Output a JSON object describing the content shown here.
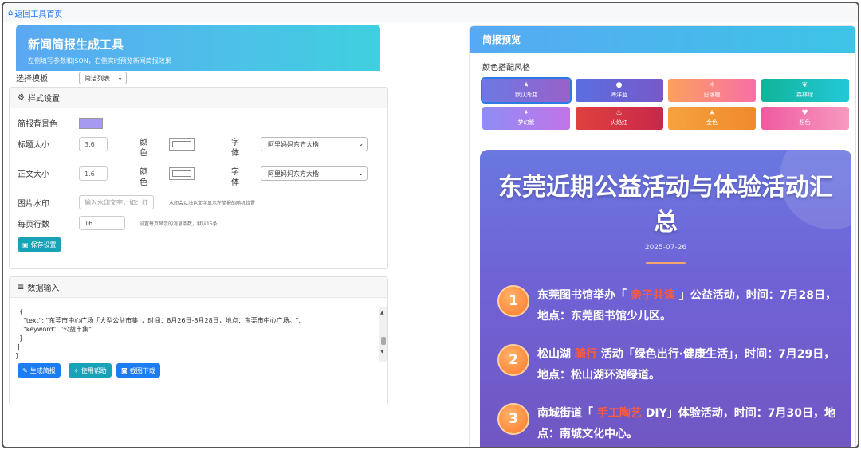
{
  "topbar": {
    "back_label": "返回工具首页"
  },
  "header": {
    "title": "新闻简报生成工具",
    "subtitle": "左侧填写参数和JSON，右侧实时预览新闻简报效果"
  },
  "template": {
    "label": "选择模板",
    "selected": "简洁列表"
  },
  "style_settings": {
    "heading": "样式设置",
    "bg_label": "简报背景色",
    "bg_color": "#a599f0",
    "title_size_label": "标题大小",
    "title_size": "3.6",
    "color_label": "颜色",
    "font_label": "字体",
    "title_font": "阿里妈妈东方大楷",
    "body_size_label": "正文大小",
    "body_size": "1.6",
    "body_font": "阿里妈妈东方大楷",
    "watermark_label": "图片水印",
    "watermark_placeholder": "输入水印文字，如：红",
    "watermark_hint": "水印会以浅色文字显示在简报的随机位置",
    "rows_label": "每页行数",
    "rows_value": "16",
    "rows_hint": "设置每页显示的消息条数，默认15条",
    "save_label": "保存设置"
  },
  "data_input": {
    "heading": "数据输入",
    "json_lines": [
      "  {",
      "    \"text\": \"东莞市中心广场「大型公益市集」，时间：8月26日-8月28日，地点：东莞市中心广场。\",",
      "    \"keyword\": \"公益市集\"",
      "  }",
      " ]",
      "}"
    ],
    "generate_label": "生成简报",
    "help_label": "使用帮助",
    "download_label": "截图下载"
  },
  "preview": {
    "heading": "简报预览",
    "scheme_title": "颜色搭配风格",
    "schemes": [
      {
        "label": "默认渐变",
        "icon": "★",
        "colors": [
          "#6c78e4",
          "#9a61c8"
        ],
        "selected": true
      },
      {
        "label": "海洋蓝",
        "icon": "●",
        "colors": [
          "#5b6fe0",
          "#7858c8"
        ]
      },
      {
        "label": "日落橙",
        "icon": "☼",
        "colors": [
          "#fba15e",
          "#f86fa6"
        ]
      },
      {
        "label": "森林绿",
        "icon": "❦",
        "colors": [
          "#11b49a",
          "#23c8d8"
        ]
      },
      {
        "label": "梦幻紫",
        "icon": "✦",
        "colors": [
          "#8f8cf4",
          "#c274e8"
        ]
      },
      {
        "label": "火焰红",
        "icon": "♨",
        "colors": [
          "#e0413f",
          "#c8284a"
        ]
      },
      {
        "label": "金色",
        "icon": "★",
        "colors": [
          "#f6a23e",
          "#f08a2c"
        ]
      },
      {
        "label": "粉色",
        "icon": "♥",
        "colors": [
          "#f05aa0",
          "#f69ac0"
        ]
      }
    ],
    "poster": {
      "title": "东莞近期公益活动与体验活动汇总",
      "date": "2025-07-26",
      "items": [
        {
          "num": "1",
          "before": "东莞图书馆举办「",
          "keyword": "亲子共读",
          "after": "」公益活动，时间：7月28日，地点：东莞图书馆少儿区。"
        },
        {
          "num": "2",
          "before": "松山湖",
          "keyword": "骑行",
          "after": "活动「绿色出行·健康生活」，时间：7月29日，地点：松山湖环湖绿道。"
        },
        {
          "num": "3",
          "before": "南城街道「",
          "keyword": "手工陶艺",
          "after": "DIY」体验活动，时间：7月30日，地点：南城文化中心。"
        }
      ]
    }
  }
}
